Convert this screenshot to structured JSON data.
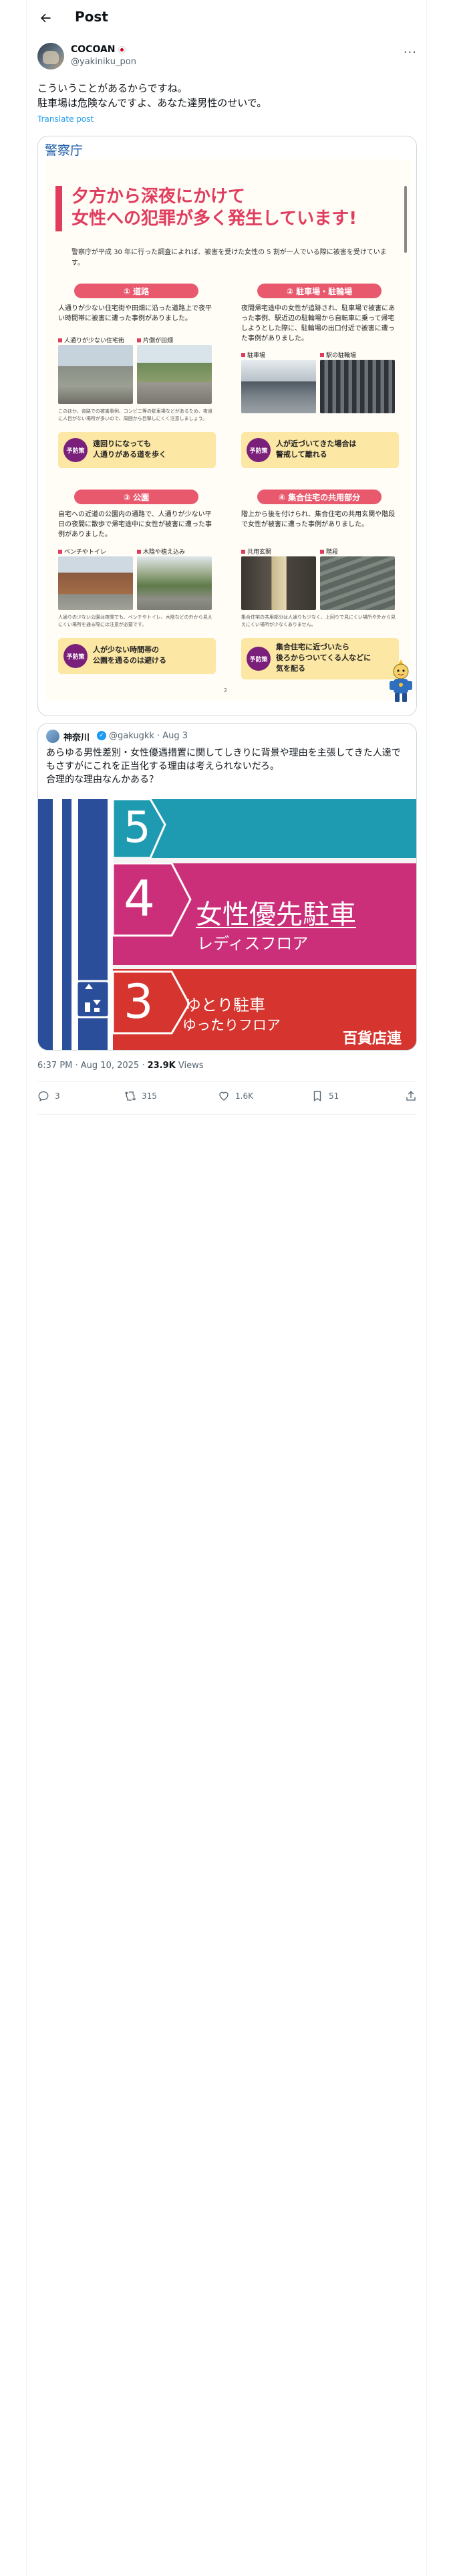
{
  "header": {
    "title": "Post"
  },
  "author": {
    "name": "COCOAN",
    "handle": "@yakiniku_pon"
  },
  "tweet": {
    "text": "こういうことがあるからですね。\n駐車場は危険なんですよ、あなた達男性のせいで。",
    "translate_label": "Translate post"
  },
  "image": {
    "police_label": "警察庁",
    "poster": {
      "title_line1": "夕方から深夜にかけて",
      "title_line2": "女性への犯罪が多く発生しています!",
      "intro": "警察庁が平成 30 年に行った調査によれば、被害を受けた女性の 5 割が一人でいる際に被害を受けています。",
      "page_number": "2",
      "sections": [
        {
          "header": "① 道路",
          "desc": "人通りが少ない住宅街や田畑に沿った道路上で夜平い時間帯に被害に遭った事例がありました。",
          "photo1_label": "人通りが少ない住宅街",
          "photo2_label": "片側が田畑",
          "caption": "このほか、道路での被害事例、コンビニ等の駐車場などがあるため、夜道に人目がない場所が多いので、周囲から目撃しにくく注意しましょう。",
          "tip": "遠回りになっても\n人通りがある道を歩く",
          "badge": "予防策"
        },
        {
          "header": "② 駐車場・駐輪場",
          "desc": "夜間帰宅途中の女性が追跡され、駐車場で被害にあった事例、駅近辺の駐輪場から自転車に乗って帰宅しようとした際に、駐輪場の出口付近で被害に遭った事例がありました。",
          "photo1_label": "駐車場",
          "photo2_label": "駅の駐輪場",
          "caption": "",
          "tip": "人が近づいてきた場合は\n警戒して離れる",
          "badge": "予防策"
        },
        {
          "header": "③ 公園",
          "desc": "自宅への近道の公園内の通路で、人通りが少ない平日の夜間に散歩で帰宅途中に女性が被害に遭った事例がありました。",
          "photo1_label": "ベンチやトイレ",
          "photo2_label": "木陰や植え込み",
          "caption": "人通りの少ない公園は夜間でも、ベンチやトイレ、木陰などの外から見えにくい場所を通る際には注意が必要です。",
          "tip": "人が少ない時間帯の\n公園を通るのは避ける",
          "badge": "予防策"
        },
        {
          "header": "④ 集合住宅の共用部分",
          "desc": "階上から後を付けられ、集合住宅の共用玄関や階段で女性が被害に遭った事例がありました。",
          "photo1_label": "共用玄関",
          "photo2_label": "階段",
          "caption": "集合住宅の共用部分は人通りも少なく、上回りで見にくい場所や外から見えにくい場所が少なくありません。",
          "tip": "集合住宅に近づいたら\n後ろからついてくる人などに\n気を配る",
          "badge": "予防策"
        }
      ]
    }
  },
  "quote": {
    "name": "神奈川",
    "handle": "@gakugkk · Aug 3",
    "text": "あらゆる男性差別・女性優遇措置に関してしきりに背景や理由を主張してきた人達でもさすがにこれを正当化する理由は考えられないだろ。\n合理的な理由なんかある？",
    "photo": {
      "floor_5": "5",
      "floor_4": "4",
      "floor_3": "3",
      "sign_main": "女性優先駐車",
      "sign_sub": "レディスフロア",
      "sign2_main": "ゆとり駐車",
      "sign2_sub": "ゆったりフロア",
      "store": "百貨店連"
    }
  },
  "meta": {
    "time": "6:37 PM · Aug 10, 2025",
    "views_count": "23.9K",
    "views_label": "Views"
  },
  "actions": {
    "replies": "3",
    "reposts": "315",
    "likes": "1.6K",
    "bookmarks": "51"
  }
}
